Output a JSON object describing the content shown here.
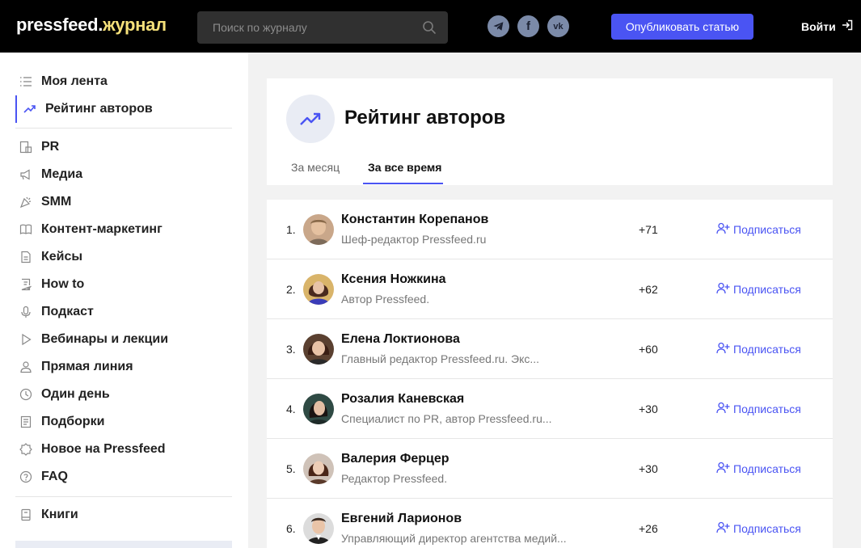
{
  "header": {
    "logo_main": "pressfeed.",
    "logo_accent": "журнал",
    "search_placeholder": "Поиск по журналу",
    "social": [
      {
        "icon": "telegram-icon",
        "color": "#7b8aa8"
      },
      {
        "icon": "facebook-icon",
        "glyph": "f",
        "color": "#7b8aa8"
      },
      {
        "icon": "vk-icon",
        "glyph": "vk",
        "color": "#7b8aa8"
      }
    ],
    "publish_label": "Опубликовать статью",
    "login_label": "Войти"
  },
  "sidebar": {
    "top_items": [
      {
        "label": "Моя лента",
        "icon": "list-icon"
      },
      {
        "label": "Рейтинг авторов",
        "icon": "trending-icon",
        "active": true
      }
    ],
    "items": [
      {
        "label": "PR",
        "icon": "pr-icon"
      },
      {
        "label": "Медиа",
        "icon": "megaphone-icon"
      },
      {
        "label": "SMM",
        "icon": "party-icon"
      },
      {
        "label": "Контент-маркетинг",
        "icon": "book-icon"
      },
      {
        "label": "Кейсы",
        "icon": "document-icon"
      },
      {
        "label": "How to",
        "icon": "checklist-icon"
      },
      {
        "label": "Подкаст",
        "icon": "microphone-icon"
      },
      {
        "label": "Вебинары и лекции",
        "icon": "play-icon"
      },
      {
        "label": "Прямая линия",
        "icon": "person-icon"
      },
      {
        "label": "Один день",
        "icon": "clock-icon"
      },
      {
        "label": "Подборки",
        "icon": "collection-icon"
      },
      {
        "label": "Новое на Pressfeed",
        "icon": "new-badge-icon"
      },
      {
        "label": "FAQ",
        "icon": "question-icon"
      }
    ],
    "bottom_items": [
      {
        "label": "Книги",
        "icon": "books-icon"
      }
    ]
  },
  "main": {
    "title": "Рейтинг авторов",
    "tabs": [
      {
        "label": "За месяц",
        "active": false
      },
      {
        "label": "За все время",
        "active": true
      }
    ],
    "subscribe_label": "Подписаться",
    "authors": [
      {
        "rank": "1.",
        "name": "Константин Корепанов",
        "role": "Шеф-редактор Pressfeed.ru",
        "score": "+71"
      },
      {
        "rank": "2.",
        "name": "Ксения Ножкина",
        "role": "Автор Pressfeed.",
        "score": "+62"
      },
      {
        "rank": "3.",
        "name": "Елена Локтионова",
        "role": "Главный редактор Pressfeed.ru. Экс...",
        "score": "+60"
      },
      {
        "rank": "4.",
        "name": "Розалия Каневская",
        "role": "Специалист по PR, автор Pressfeed.ru...",
        "score": "+30"
      },
      {
        "rank": "5.",
        "name": "Валерия Ферцер",
        "role": "Редактор Pressfeed.",
        "score": "+30"
      },
      {
        "rank": "6.",
        "name": "Евгений Ларионов",
        "role": "Управляющий директор агентства медий...",
        "score": "+26"
      }
    ]
  },
  "colors": {
    "accent": "#4a54f3",
    "header_bg": "#000000",
    "logo_accent": "#f5e17a"
  }
}
